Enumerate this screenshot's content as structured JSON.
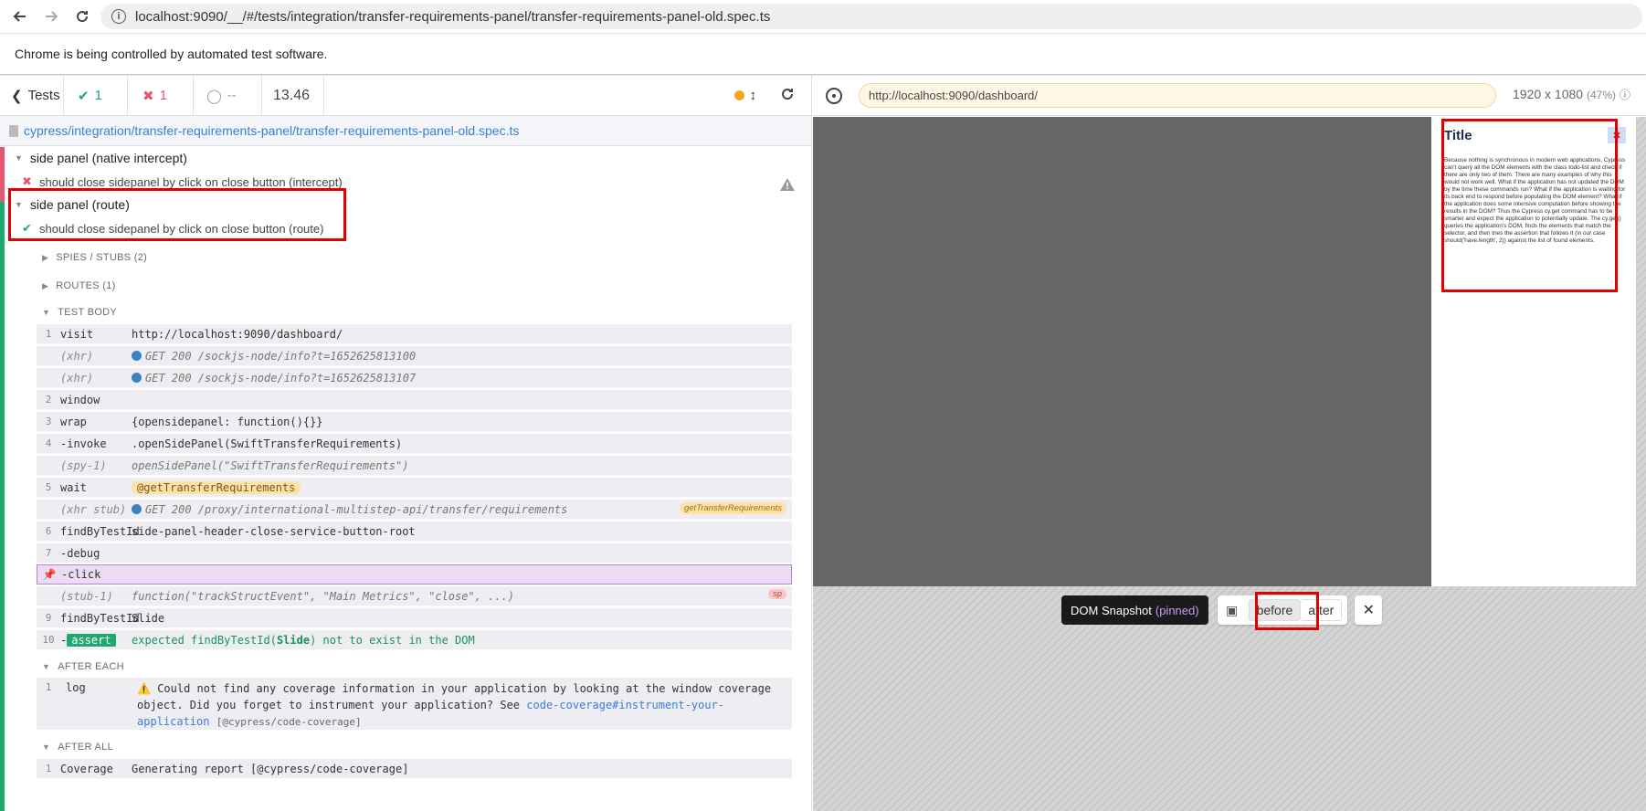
{
  "browser": {
    "url": "localhost:9090/__/#/tests/integration/transfer-requirements-panel/transfer-requirements-panel-old.spec.ts",
    "automation_notice": "Chrome is being controlled by automated test software."
  },
  "reporter": {
    "tests_label": "Tests",
    "passed_count": "1",
    "failed_count": "1",
    "pending_count": "--",
    "duration": "13.46",
    "spec_path": "cypress/integration/transfer-requirements-panel/transfer-requirements-panel-old.spec.ts",
    "suites": [
      {
        "title": "side panel (native intercept)",
        "test": "should close sidepanel by click on close button (intercept)"
      },
      {
        "title": "side panel (route)",
        "test": "should close sidepanel by click on close button (route)"
      }
    ],
    "sections": {
      "spies": "SPIES / STUBS (2)",
      "routes": "ROUTES (1)",
      "body": "TEST BODY",
      "after_each": "AFTER EACH",
      "after_all": "AFTER ALL"
    },
    "commands": [
      {
        "num": "1",
        "name": "visit",
        "msg": "http://localhost:9090/dashboard/"
      },
      {
        "num": "",
        "name": "(xhr)",
        "msg": "GET 200 /sockjs-node/info?t=1652625813100"
      },
      {
        "num": "",
        "name": "(xhr)",
        "msg": "GET 200 /sockjs-node/info?t=1652625813107"
      },
      {
        "num": "2",
        "name": "window",
        "msg": ""
      },
      {
        "num": "3",
        "name": "wrap",
        "msg": "{opensidepanel: function(){}}"
      },
      {
        "num": "4",
        "name": "-invoke",
        "msg": ".openSidePanel(SwiftTransferRequirements)"
      },
      {
        "num": "",
        "name": "(spy-1)",
        "msg": "openSidePanel(\"SwiftTransferRequirements\")"
      },
      {
        "num": "5",
        "name": "wait",
        "msg": "@getTransferRequirements"
      },
      {
        "num": "",
        "name": "(xhr stub)",
        "msg": "GET 200 /proxy/international-multistep-api/transfer/requirements",
        "alias": "getTransferRequirements"
      },
      {
        "num": "6",
        "name": "findByTestId",
        "msg": "side-panel-header-close-service-button-root"
      },
      {
        "num": "7",
        "name": "-debug",
        "msg": ""
      },
      {
        "num": "",
        "name": "-click",
        "msg": ""
      },
      {
        "num": "",
        "name": "(stub-1)",
        "msg": "function(\"trackStructEvent\", \"Main Metrics\", \"close\", ...)",
        "alias": "sp"
      },
      {
        "num": "9",
        "name": "findByTestId",
        "msg": "Slide"
      },
      {
        "num": "10",
        "name": "-",
        "badge": "assert",
        "msg_pre": "expected findByTestId(",
        "msg_bold": "Slide",
        "msg_post": ") not to exist in the DOM"
      }
    ],
    "after_each_log": {
      "num": "1",
      "name": "log",
      "warn": "⚠️",
      "line1": "Could not find any coverage information in your application by looking at the window coverage",
      "line2_pre": "object. Did you forget to instrument your application? See ",
      "link1": "code-coverage#instrument-your-",
      "link2": "application",
      "tail": "[@cypress/code-coverage]"
    },
    "after_all_log": {
      "num": "1",
      "name": "Coverage",
      "msg": "Generating report [@cypress/code-coverage]"
    }
  },
  "aut": {
    "url": "http://localhost:9090/dashboard/",
    "viewport": "1920 x 1080",
    "scale": "(47%)",
    "side_panel": {
      "title": "Title",
      "body": "Because nothing is synchronous in modern web applications, Cypress can't query all the DOM elements with the class todo-list and check if there are only two of them. There are many examples of why this would not work well. What if the application has not updated the DOM by the time these commands run? What if the application is waiting for its back end to respond before populating the DOM element? What if the application does some intensive computation before showing the results in the DOM? Thus the Cypress cy.get command has to be smarter and expect the application to potentially update. The cy.get() queries the application's DOM, finds the elements that match the selector, and then tries the assertion that follows it (in our case should('have.length', 2)) against the list of found elements."
    },
    "snapshot": {
      "label": "DOM Snapshot",
      "pinned": "(pinned)",
      "before": "before",
      "after": "after"
    }
  },
  "colors": {
    "pass": "#1fa971",
    "fail": "#e45770",
    "highlight": "#e00000"
  }
}
